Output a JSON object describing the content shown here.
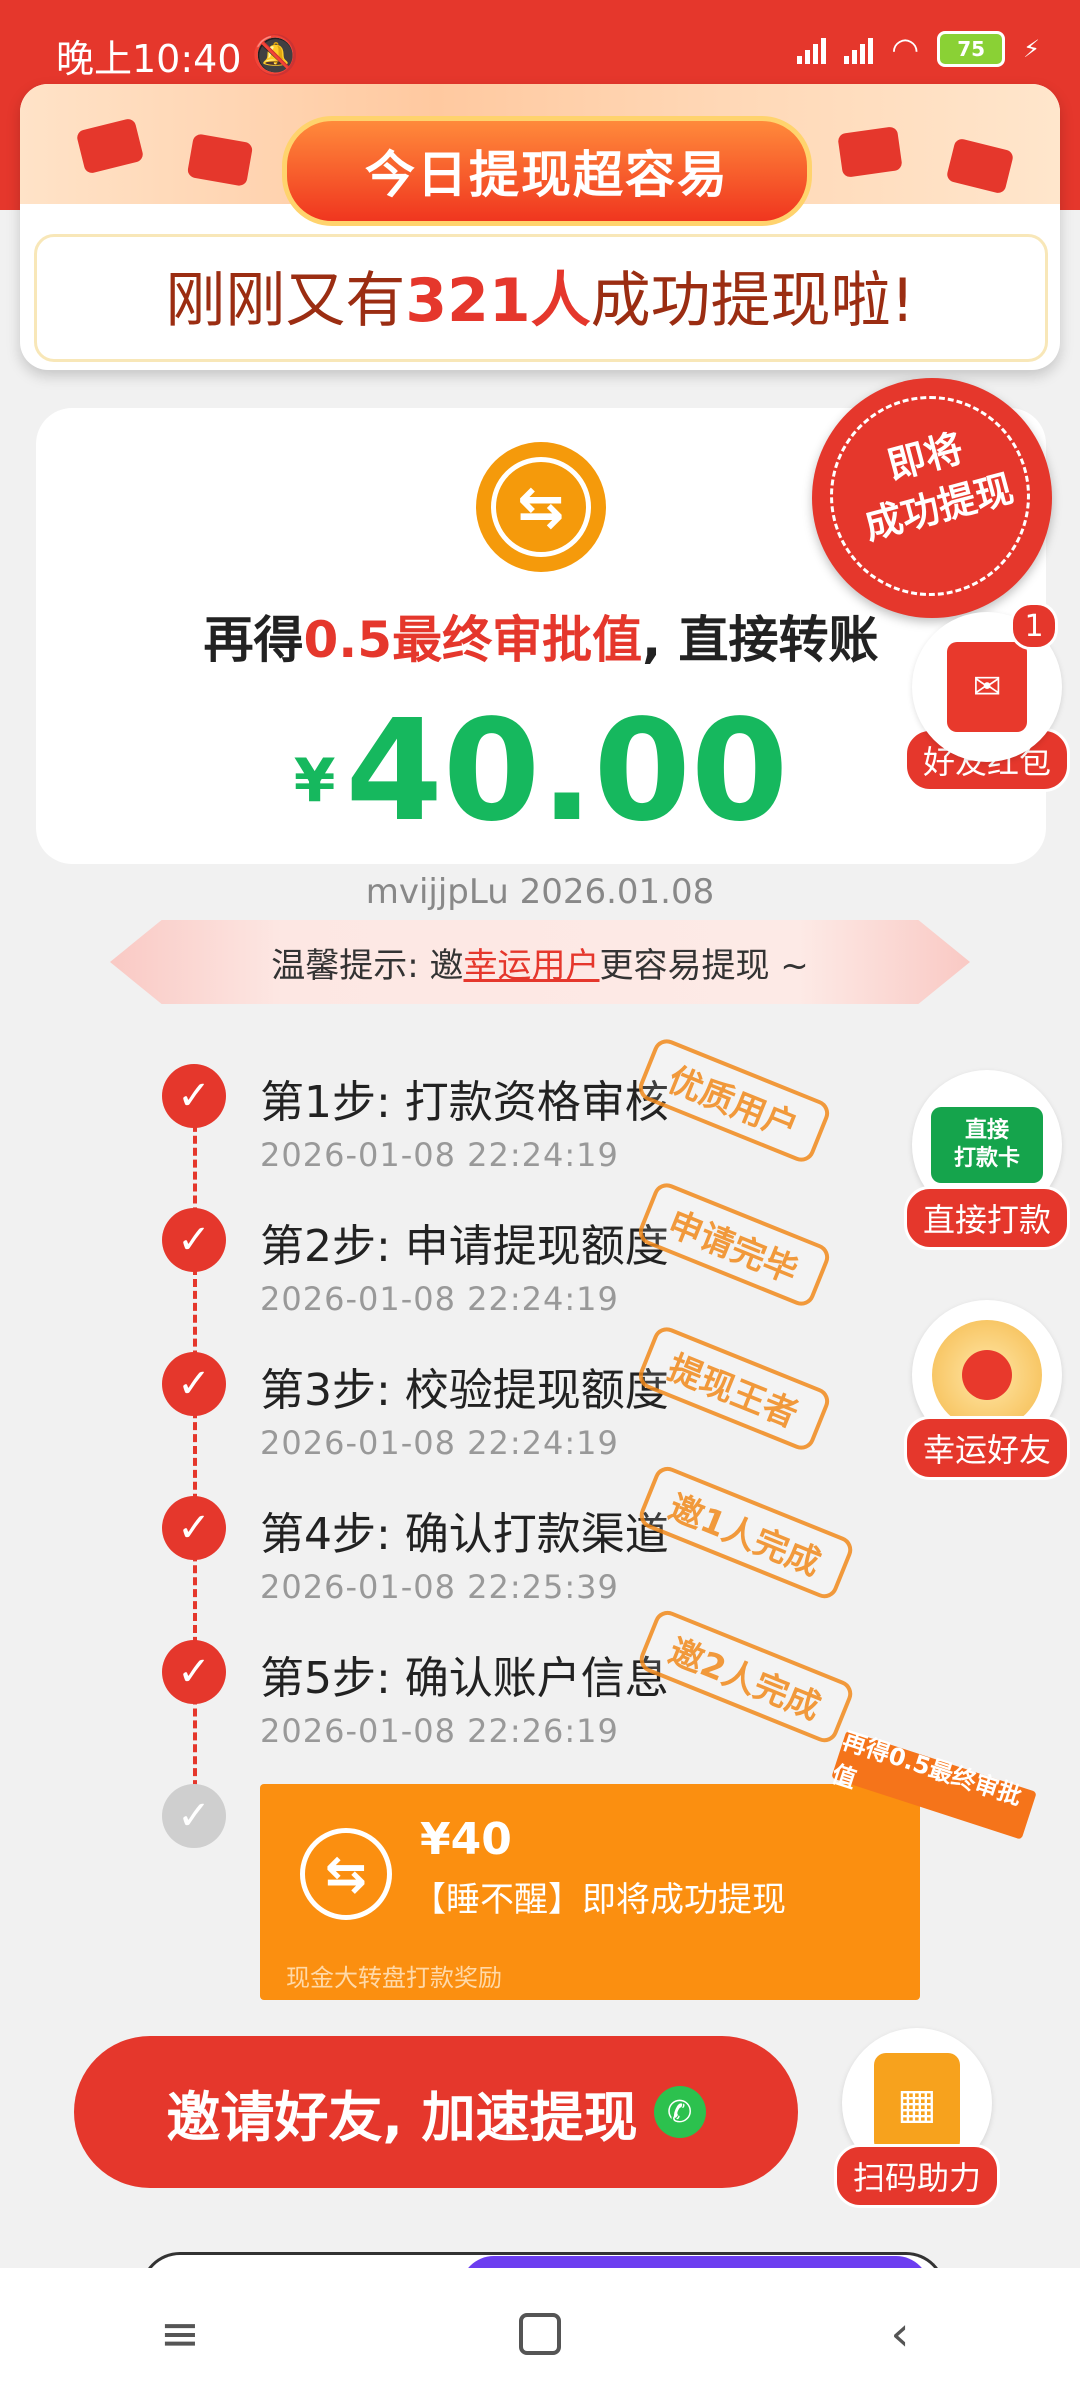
{
  "status_bar": {
    "time": "晚上10:40",
    "battery": "75"
  },
  "banner": {
    "pill_text": "今日提现超容易",
    "text_prefix": "刚刚又有",
    "count": "321",
    "unit": "人",
    "text_suffix": "成功提现啦!"
  },
  "seal": {
    "line1": "即将",
    "line2": "成功提现"
  },
  "card": {
    "line_prefix": "再得",
    "highlight": "0.5最终审批值",
    "line_suffix": ", 直接转账",
    "currency": "¥",
    "amount": "40.00"
  },
  "meta": "mvijjpLu 2026.01.08",
  "tip": {
    "prefix": "温馨提示: 邀",
    "link": "幸运用户",
    "suffix": "更容易提现 ~"
  },
  "side_buttons": {
    "hongbao": {
      "label": "好友红包",
      "badge": "1"
    },
    "direct": {
      "label": "直接打款",
      "card_line1": "直接",
      "card_line2": "打款卡"
    },
    "lucky": {
      "label": "幸运好友"
    },
    "scan": {
      "label": "扫码助力"
    }
  },
  "steps": [
    {
      "title": "第1步: 打款资格审核",
      "time": "2026-01-08 22:24:19",
      "stamp": "优质用户"
    },
    {
      "title": "第2步: 申请提现额度",
      "time": "2026-01-08 22:24:19",
      "stamp": "申请完毕"
    },
    {
      "title": "第3步: 校验提现额度",
      "time": "2026-01-08 22:24:19",
      "stamp": "提现王者"
    },
    {
      "title": "第4步: 确认打款渠道",
      "time": "2026-01-08 22:25:39",
      "stamp": "邀1人完成"
    },
    {
      "title": "第5步: 确认账户信息",
      "time": "2026-01-08 22:26:19",
      "stamp": "邀2人完成"
    }
  ],
  "result_card": {
    "amount": "¥40",
    "desc": "【睡不醒】即将成功提现",
    "footer": "现金大转盘打款奖励",
    "ribbon": "再得0.5最终审批值"
  },
  "invite_button": {
    "label": "邀请好友, 加速提现"
  },
  "colors": {
    "primary_red": "#e5372c",
    "green_amount": "#16b85e",
    "orange": "#fb8f10"
  }
}
